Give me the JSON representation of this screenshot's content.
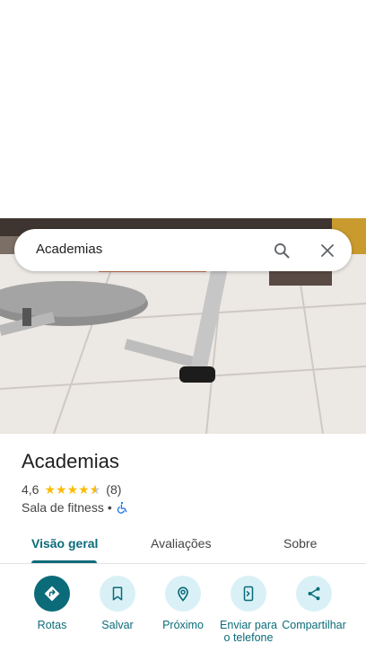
{
  "search": {
    "query": "Academias"
  },
  "place": {
    "title": "Academias",
    "rating": "4,6",
    "rating_value": 4.6,
    "review_count": "(8)",
    "category": "Sala de fitness",
    "separator": "•"
  },
  "tabs": [
    {
      "label": "Visão geral",
      "active": true
    },
    {
      "label": "Avaliações",
      "active": false
    },
    {
      "label": "Sobre",
      "active": false
    }
  ],
  "actions": [
    {
      "label": "Rotas",
      "icon": "directions-icon"
    },
    {
      "label": "Salvar",
      "icon": "bookmark-icon"
    },
    {
      "label": "Próximo",
      "icon": "nearby-icon"
    },
    {
      "label": "Enviar para o telefone",
      "icon": "send-to-phone-icon"
    },
    {
      "label": "Compartilhar",
      "icon": "share-icon"
    }
  ],
  "colors": {
    "accent": "#0b6b79",
    "accent_light": "#d9f1f6",
    "star": "#fbbc04"
  }
}
